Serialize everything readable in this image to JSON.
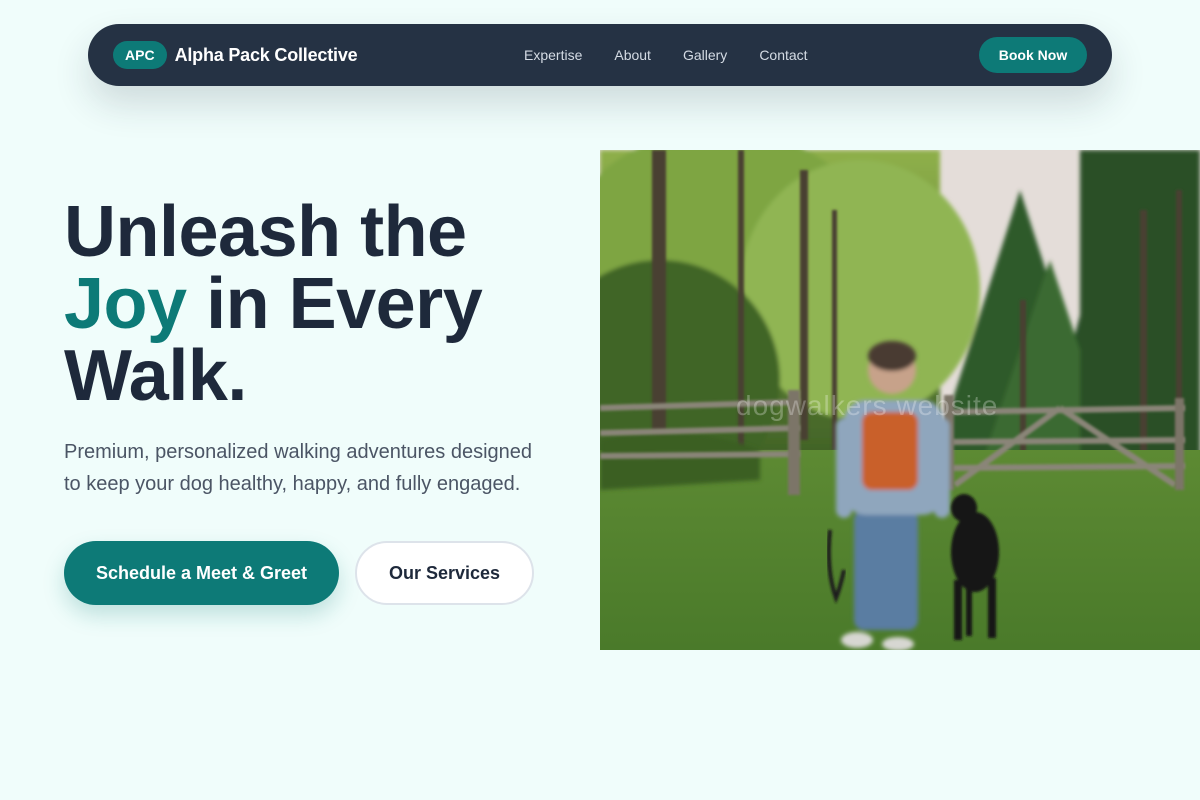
{
  "nav": {
    "logo_abbr": "APC",
    "brand_name": "Alpha Pack Collective",
    "links": [
      "Expertise",
      "About",
      "Gallery",
      "Contact"
    ],
    "cta_label": "Book Now"
  },
  "hero": {
    "title_line1": "Unleash the",
    "title_accent": "Joy",
    "title_line2_rest": " in Every",
    "title_line3": "Walk.",
    "subtitle": "Premium, personalized walking adventures designed to keep your dog healthy, happy, and fully engaged.",
    "primary_cta": "Schedule a Meet & Greet",
    "secondary_cta": "Our Services"
  },
  "image": {
    "watermark": "dogwalkers website"
  },
  "colors": {
    "accent": "#0d7a77",
    "navbar": "#253244",
    "page_background": "#f0fdfb",
    "heading": "#1e293b"
  }
}
